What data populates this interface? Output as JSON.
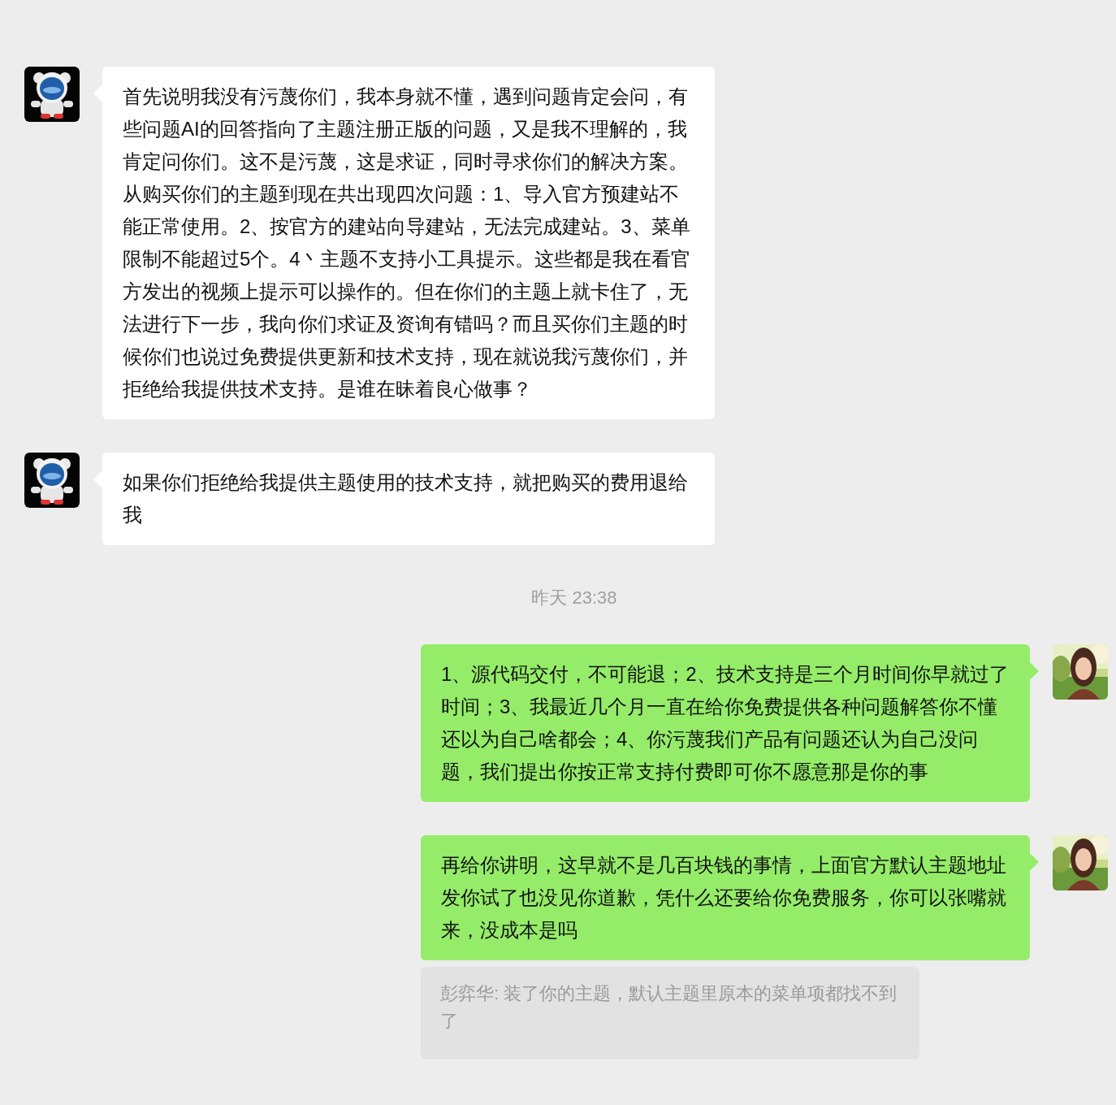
{
  "messages": [
    {
      "kind": "incoming",
      "text": "首先说明我没有污蔑你们，我本身就不懂，遇到问题肯定会问，有些问题AI的回答指向了主题注册正版的问题，又是我不理解的，我肯定问你们。这不是污蔑，这是求证，同时寻求你们的解决方案。从购买你们的主题到现在共出现四次问题：1、导入官方预建站不能正常使用。2、按官方的建站向导建站，无法完成建站。3、菜单限制不能超过5个。4丶主题不支持小工具提示。这些都是我在看官方发出的视频上提示可以操作的。但在你们的主题上就卡住了，无法进行下一步，我向你们求证及资询有错吗？而且买你们主题的时候你们也说过免费提供更新和技术支持，现在就说我污蔑你们，并拒绝给我提供技术支持。是谁在昧着良心做事？"
    },
    {
      "kind": "incoming",
      "text": "如果你们拒绝给我提供主题使用的技术支持，就把购买的费用退给我"
    },
    {
      "kind": "time",
      "text": "昨天 23:38"
    },
    {
      "kind": "outgoing",
      "text": "1、源代码交付，不可能退；2、技术支持是三个月时间你早就过了时间；3、我最近几个月一直在给你免费提供各种问题解答你不懂还以为自己啥都会；4、你污蔑我们产品有问题还认为自己没问题，我们提出你按正常支持付费即可你不愿意那是你的事"
    },
    {
      "kind": "outgoing",
      "text": "再给你讲明，这早就不是几百块钱的事情，上面官方默认主题地址发你试了也没见你道歉，凭什么还要给你免费服务，你可以张嘴就来，没成本是吗",
      "quote": "彭弈华: 装了你的主题，默认主题里原本的菜单项都找不到了"
    }
  ]
}
